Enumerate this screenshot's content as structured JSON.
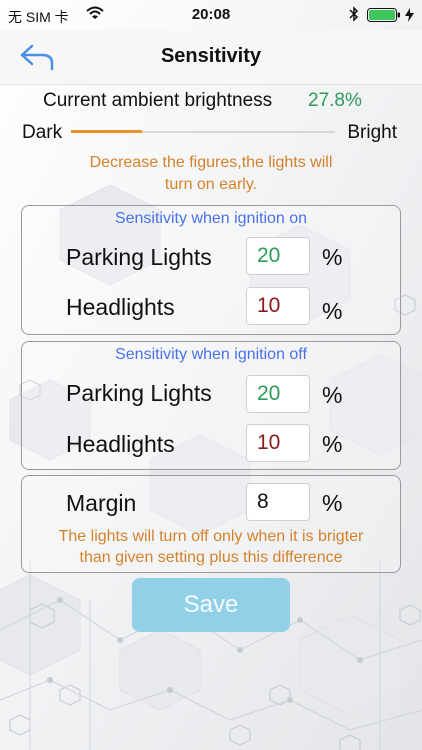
{
  "status_bar": {
    "carrier": "无 SIM 卡",
    "time": "20:08",
    "wifi_icon": "wifi-icon",
    "bluetooth_icon": "bluetooth-icon",
    "battery_icon": "battery-icon",
    "battery_color": "#3dc75a"
  },
  "nav": {
    "back_icon": "back-arrow-icon",
    "title": "Sensitivity",
    "accent": "#4a90e2"
  },
  "ambient": {
    "label": "Current ambient brightness",
    "value": "27.8%",
    "value_color": "#2e9b5a"
  },
  "brightness_slider": {
    "min_label": "Dark",
    "max_label": "Bright",
    "level": 0.27,
    "fill_color": "#e8912d"
  },
  "hint_top": {
    "line1": "Decrease the figures,the lights will",
    "line2": "turn on early."
  },
  "ignition_on": {
    "title": "Sensitivity when ignition on",
    "parking_label": "Parking Lights",
    "parking_value": "20",
    "parking_color": "#2e9b5a",
    "headlights_label": "Headlights",
    "headlights_value": "10",
    "headlights_color": "#8b1a1a",
    "unit": "%"
  },
  "ignition_off": {
    "title": "Sensitivity when ignition off",
    "parking_label": "Parking Lights",
    "parking_value": "20",
    "parking_color": "#2e9b5a",
    "headlights_label": "Headlights",
    "headlights_value": "10",
    "headlights_color": "#8b1a1a",
    "unit": "%"
  },
  "margin": {
    "label": "Margin",
    "value": "8",
    "unit": "%",
    "hint_line1": "The lights will turn off only when it is brigter",
    "hint_line2": "than given setting plus this difference"
  },
  "save_label": "Save"
}
